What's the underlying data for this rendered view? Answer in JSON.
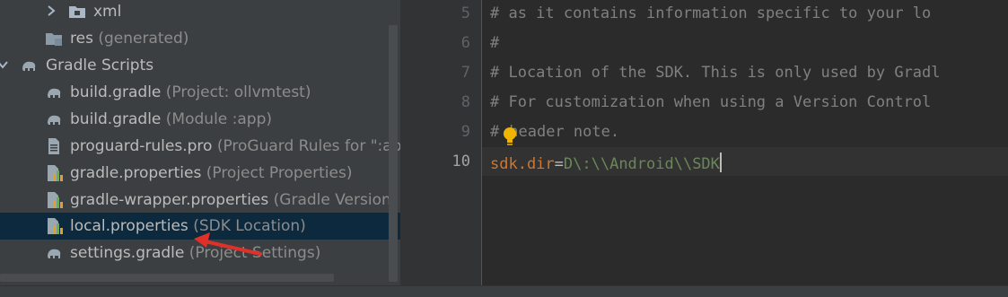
{
  "project_tree": {
    "items": [
      {
        "name": "xml",
        "hint": ""
      },
      {
        "name": "res",
        "hint": "(generated)"
      },
      {
        "name": "Gradle Scripts",
        "hint": ""
      },
      {
        "name": "build.gradle",
        "hint": "(Project: ollvmtest)"
      },
      {
        "name": "build.gradle",
        "hint": "(Module :app)"
      },
      {
        "name": "proguard-rules.pro",
        "hint": "(ProGuard Rules for \":ap"
      },
      {
        "name": "gradle.properties",
        "hint": "(Project Properties)"
      },
      {
        "name": "gradle-wrapper.properties",
        "hint": "(Gradle Version)"
      },
      {
        "name": "local.properties",
        "hint": "(SDK Location)"
      },
      {
        "name": "settings.gradle",
        "hint": "(Project Settings)"
      }
    ],
    "selected": "local.properties"
  },
  "editor": {
    "line_numbers": [
      "5",
      "6",
      "7",
      "8",
      "9",
      "10"
    ],
    "current_line": "10",
    "lines": [
      "# as it contains information specific to your lo",
      "#",
      "# Location of the SDK. This is only used by Gradl",
      "# For customization when using a Version Control",
      "header note."
    ],
    "line9_prefix": "#",
    "sdk_key": "sdk.dir",
    "sdk_eq": "=",
    "sdk_value": "D\\:\\\\Android\\\\SDK"
  },
  "colors": {
    "comment": "#808080",
    "key": "#cc7832",
    "value": "#6a8759",
    "selection": "#0d293e",
    "arrow": "#e0302a",
    "bulb": "#f0b400"
  },
  "icons": [
    "chevron-right-icon",
    "folder-icon",
    "gradle-elephant-icon",
    "properties-file-icon",
    "text-file-icon",
    "lightbulb-icon"
  ]
}
